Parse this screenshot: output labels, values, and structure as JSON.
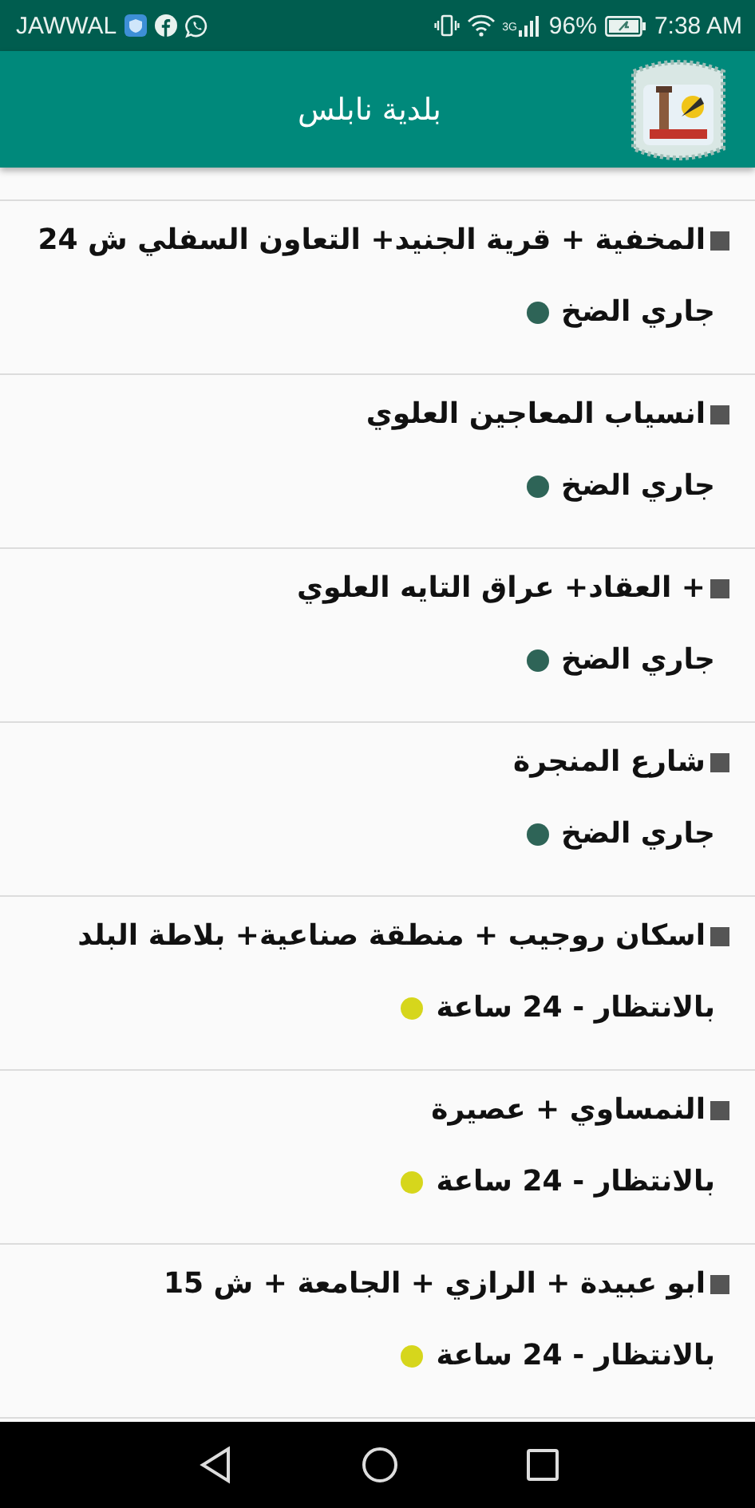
{
  "status_bar": {
    "carrier": "JAWWAL",
    "network": "3G",
    "battery": "96%",
    "time": "7:38 AM"
  },
  "app_bar": {
    "title": "بلدية نابلس"
  },
  "rows": [
    {
      "title": "المخفية + قرية الجنيد+ التعاون السفلي ش 24",
      "status": "جاري الضخ",
      "color": "#2e6457"
    },
    {
      "title": "انسياب المعاجين العلوي",
      "status": "جاري الضخ",
      "color": "#2e6457"
    },
    {
      "title": "+ العقاد+ عراق التايه العلوي",
      "status": "جاري الضخ",
      "color": "#2e6457"
    },
    {
      "title": "شارع المنجرة",
      "status": "جاري الضخ",
      "color": "#2e6457"
    },
    {
      "title": "اسكان روجيب + منطقة صناعية+ بلاطة البلد",
      "status": "بالانتظار - 24 ساعة",
      "color": "#d6d61c"
    },
    {
      "title": "النمساوي + عصيرة",
      "status": "بالانتظار - 24 ساعة",
      "color": "#d6d61c"
    },
    {
      "title": "ابو عبيدة + الرازي + الجامعة + ش 15",
      "status": "بالانتظار - 24 ساعة",
      "color": "#d6d61c"
    }
  ]
}
